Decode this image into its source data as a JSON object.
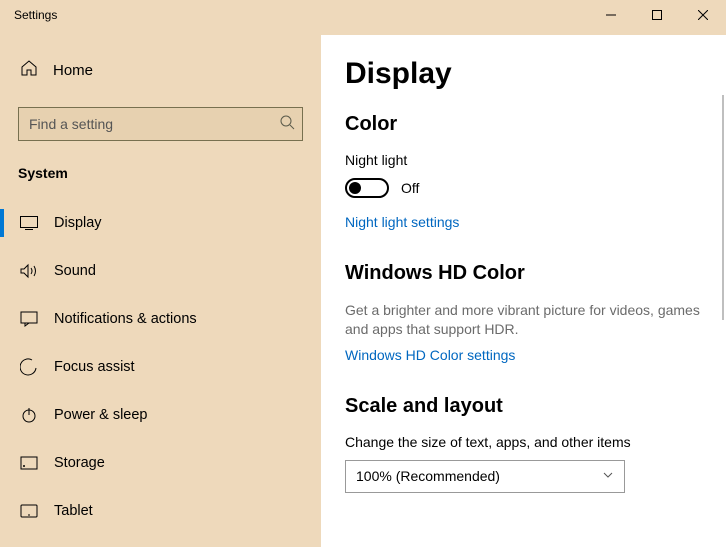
{
  "window": {
    "title": "Settings"
  },
  "sidebar": {
    "home_label": "Home",
    "search_placeholder": "Find a setting",
    "section_title": "System",
    "items": [
      {
        "label": "Display"
      },
      {
        "label": "Sound"
      },
      {
        "label": "Notifications & actions"
      },
      {
        "label": "Focus assist"
      },
      {
        "label": "Power & sleep"
      },
      {
        "label": "Storage"
      },
      {
        "label": "Tablet"
      }
    ]
  },
  "main": {
    "page_title": "Display",
    "color": {
      "heading": "Color",
      "night_light_label": "Night light",
      "night_light_state": "Off",
      "night_light_link": "Night light settings"
    },
    "hdcolor": {
      "heading": "Windows HD Color",
      "description": "Get a brighter and more vibrant picture for videos, games and apps that support HDR.",
      "link": "Windows HD Color settings"
    },
    "scale": {
      "heading": "Scale and layout",
      "label": "Change the size of text, apps, and other items",
      "selected": "100% (Recommended)"
    }
  }
}
